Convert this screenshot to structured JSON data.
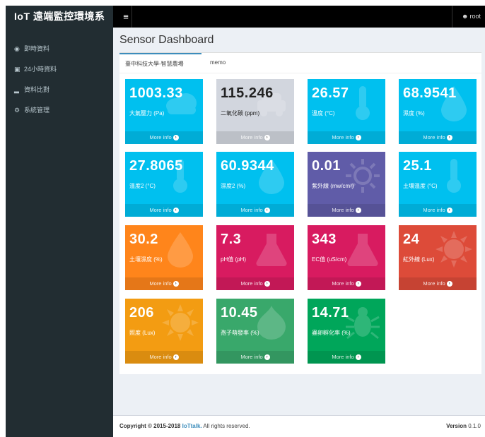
{
  "app": {
    "brand": "IoT 遠端監控環境系"
  },
  "topbar": {
    "menu_icon": "bars-icon",
    "user": "root",
    "user_icon": "user-icon"
  },
  "sidebar": {
    "items": [
      {
        "label": "即時資料",
        "icon": "dashboard-icon"
      },
      {
        "label": "24小時資料",
        "icon": "book-icon"
      },
      {
        "label": "資料比對",
        "icon": "bar-chart-icon"
      },
      {
        "label": "系統管理",
        "icon": "gears-icon"
      }
    ]
  },
  "page": {
    "title": "Sensor Dashboard"
  },
  "tabs": [
    {
      "label": "臺中科技大學-智慧農場",
      "active": true
    },
    {
      "label": "memo",
      "active": false
    }
  ],
  "more_info": "More info",
  "tiles": [
    {
      "value": "1003.33",
      "label": "大氣壓力 (Pa)",
      "color": "#00c0ef",
      "icon": "cloud-icon"
    },
    {
      "value": "115.246",
      "label": "二氧化碳 (ppm)",
      "color": "#d2d6de",
      "icon": "car-icon"
    },
    {
      "value": "26.57",
      "label": "溫度 (°C)",
      "color": "#00c0ef",
      "icon": "thermometer-icon"
    },
    {
      "value": "68.9541",
      "label": "濕度 (%)",
      "color": "#00c0ef",
      "icon": "water-drop-icon"
    },
    {
      "value": "27.8065",
      "label": "溫度2 (°C)",
      "color": "#00c0ef",
      "icon": "thermometer-icon"
    },
    {
      "value": "60.9344",
      "label": "濕度2 (%)",
      "color": "#00c0ef",
      "icon": "water-drop-icon"
    },
    {
      "value": "0.01",
      "label": "紫外線 (mw/cm²)",
      "color": "#605ca8",
      "icon": "sun-outline-icon"
    },
    {
      "value": "25.1",
      "label": "土壤溫度 (°C)",
      "color": "#00c0ef",
      "icon": "thermometer-icon"
    },
    {
      "value": "30.2",
      "label": "土壤濕度 (%)",
      "color": "#ff851b",
      "icon": "water-drop-icon"
    },
    {
      "value": "7.3",
      "label": "pH值 (pH)",
      "color": "#d81b60",
      "icon": "flask-icon"
    },
    {
      "value": "343",
      "label": "EC值 (uS/cm)",
      "color": "#d81b60",
      "icon": "flask-icon"
    },
    {
      "value": "24",
      "label": "紅外線 (Lux)",
      "color": "#dd4b39",
      "icon": "sun-icon"
    },
    {
      "value": "206",
      "label": "照度 (Lux)",
      "color": "#f39c12",
      "icon": "sun-icon"
    },
    {
      "value": "10.45",
      "label": "孢子萌發率 (%)",
      "color": "#39a86b",
      "icon": "drupal-icon"
    },
    {
      "value": "14.71",
      "label": "蟲卵孵化率 (%)",
      "color": "#00a65a",
      "icon": "bug-icon"
    }
  ],
  "footer": {
    "copyright_prefix": "Copyright © 2015-2018",
    "brand": "IoTtalk.",
    "rights": "All rights reserved.",
    "version_label": "Version",
    "version": "0.1.0"
  }
}
